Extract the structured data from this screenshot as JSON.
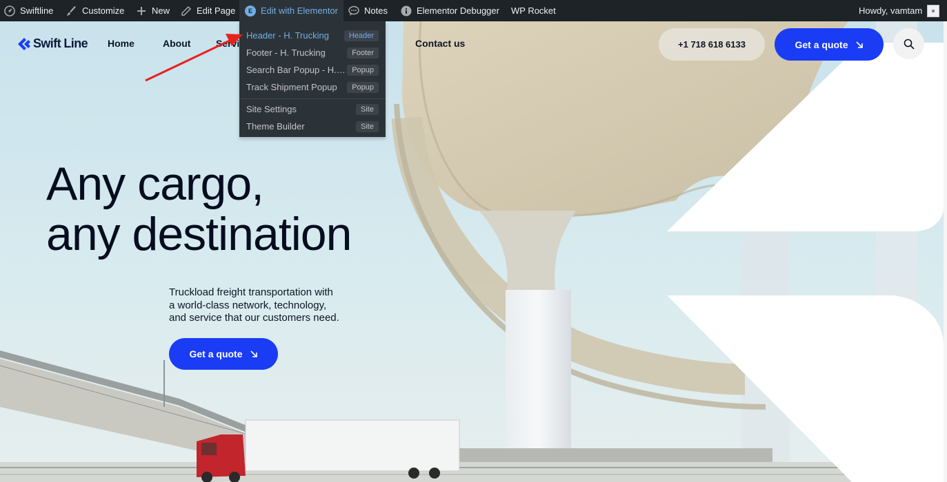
{
  "adminbar": {
    "site_name": "Swiftline",
    "customize": "Customize",
    "new": "New",
    "edit_page": "Edit Page",
    "edit_with_elementor": "Edit with Elementor",
    "elementor_badge": "E",
    "notes": "Notes",
    "elementor_debugger": "Elementor Debugger",
    "wp_rocket": "WP Rocket",
    "howdy": "Howdy, vamtam"
  },
  "dropdown": {
    "items": [
      {
        "label": "Header - H. Trucking",
        "badge": "Header"
      },
      {
        "label": "Footer - H. Trucking",
        "badge": "Footer"
      },
      {
        "label": "Search Bar Popup - H. Trucking",
        "badge": "Popup"
      },
      {
        "label": "Track Shipment Popup",
        "badge": "Popup"
      },
      {
        "label": "Site Settings",
        "badge": "Site"
      },
      {
        "label": "Theme Builder",
        "badge": "Site"
      }
    ]
  },
  "header": {
    "logo_text": "Swift Line",
    "nav": [
      "Home",
      "About",
      "Services",
      "Contact us"
    ],
    "phone": "+1 718 618 6133",
    "quote_label": "Get a quote"
  },
  "hero": {
    "title_line1": "Any cargo,",
    "title_line2": "any destination",
    "desc_line1": "Truckload freight transportation with",
    "desc_line2": "a world-class network, technology,",
    "desc_line3": "and service that our customers need.",
    "cta_label": "Get a quote"
  },
  "colors": {
    "brand_blue": "#1a3cf5",
    "admin_bar": "#1d2327",
    "admin_highlight": "#72aee6",
    "annotation_red": "#e8211f"
  }
}
